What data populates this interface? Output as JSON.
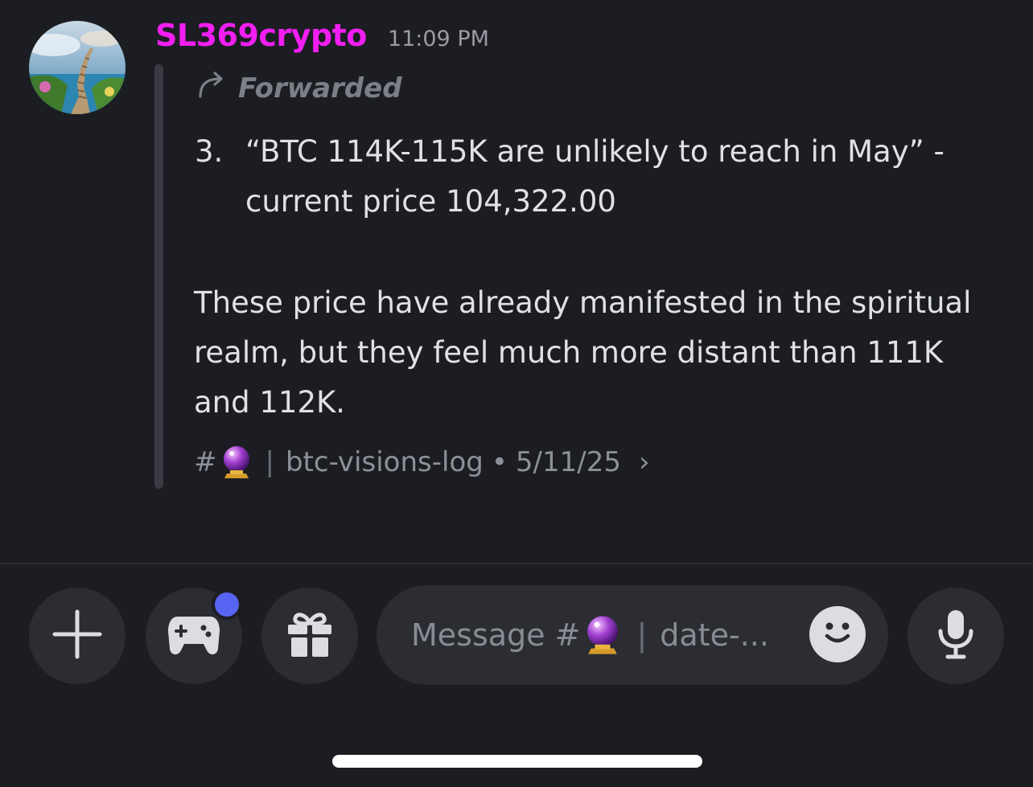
{
  "message": {
    "author": "SL369crypto",
    "time": "11:09 PM",
    "author_color": "#f21ef2",
    "forwarded_label": "Forwarded",
    "list_number": "3.",
    "list_text": "“BTC 114K-115K are unlikely to reach in May” - current price 104,322.00",
    "paragraph": "These price have already manifested in the spiritual realm, but they feel much more distant than 111K and 112K.",
    "source": {
      "hash": "#",
      "channel_icon": "crystal-ball-icon",
      "separator": "|",
      "channel": "btc-visions-log",
      "dot": "•",
      "date": "5/11/25",
      "chevron": "›"
    }
  },
  "composer": {
    "placeholder_prefix": "Message #",
    "placeholder_sep": "|",
    "placeholder_channel": "date-...",
    "buttons": [
      "plus-icon",
      "gamepad-icon",
      "gift-icon",
      "microphone-icon"
    ],
    "accent_color": "#5865f2"
  }
}
